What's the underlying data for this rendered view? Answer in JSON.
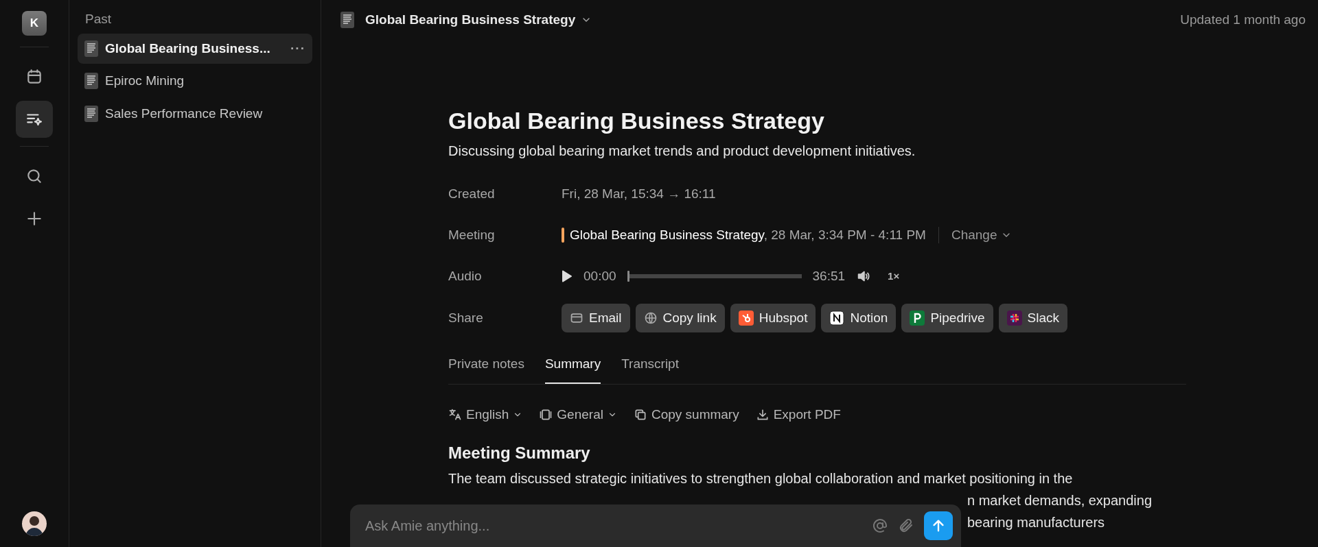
{
  "rail": {
    "avatar_letter": "K",
    "items": [
      {
        "kind": "calendar",
        "selected": false
      },
      {
        "kind": "notes",
        "selected": true
      },
      {
        "kind": "search",
        "selected": false
      },
      {
        "kind": "add",
        "selected": false
      }
    ]
  },
  "sidebar": {
    "section": "Past",
    "items": [
      {
        "label": "Global Bearing Business...",
        "selected": true,
        "more": "···"
      },
      {
        "label": "Epiroc Mining",
        "selected": false
      },
      {
        "label": "Sales Performance Review",
        "selected": false
      }
    ]
  },
  "header": {
    "title": "Global Bearing Business Strategy",
    "updated": "Updated 1 month ago"
  },
  "note": {
    "title": "Global Bearing Business Strategy",
    "subtitle": "Discussing global bearing market trends and product development initiatives.",
    "created": {
      "label": "Created",
      "value": "Fri, 28 Mar, 15:34 → 16:11"
    },
    "meeting": {
      "label": "Meeting",
      "color": "#f5a45d",
      "name": "Global Bearing Business Strategy",
      "time": ", 28 Mar, 3:34 PM - 4:11 PM",
      "change": "Change"
    },
    "audio": {
      "label": "Audio",
      "current": "00:00",
      "level": 0,
      "duration": "36:51",
      "speed": "1×"
    },
    "share": {
      "label": "Share",
      "targets": [
        {
          "kind": "email",
          "label": "Email"
        },
        {
          "kind": "link",
          "label": "Copy link"
        },
        {
          "kind": "hubspot",
          "label": "Hubspot"
        },
        {
          "kind": "notion",
          "label": "Notion"
        },
        {
          "kind": "pipedrive",
          "label": "Pipedrive"
        },
        {
          "kind": "slack",
          "label": "Slack"
        }
      ]
    }
  },
  "tabs": [
    {
      "label": "Private notes",
      "selected": false
    },
    {
      "label": "Summary",
      "selected": true
    },
    {
      "label": "Transcript",
      "selected": false
    }
  ],
  "toolbar": [
    {
      "kind": "language",
      "label": "English",
      "dropdown": true
    },
    {
      "kind": "template",
      "label": "General",
      "dropdown": true
    },
    {
      "kind": "copy",
      "label": "Copy summary",
      "dropdown": false
    },
    {
      "kind": "export",
      "label": "Export PDF",
      "dropdown": false
    }
  ],
  "summary": {
    "heading": "Meeting Summary",
    "lines": [
      "The team discussed strategic initiatives to strengthen global collaboration and market positioning in the",
      "n market demands, expanding",
      "bearing manufacturers"
    ]
  },
  "chat": {
    "placeholder": "Ask Amie anything..."
  }
}
